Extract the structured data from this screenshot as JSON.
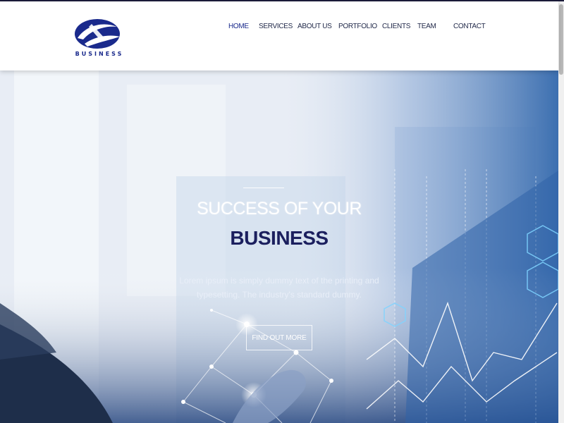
{
  "brand": {
    "logo_text": "BUSINESS",
    "color": "#1a2a8c"
  },
  "nav": {
    "items": [
      {
        "label": "HOME",
        "active": true
      },
      {
        "label": "SERVICES"
      },
      {
        "label": "ABOUT US"
      },
      {
        "label": "PORTFOLIO"
      },
      {
        "label": "CLIENTS"
      },
      {
        "label": "TEAM"
      },
      {
        "label": "CONTACT"
      }
    ]
  },
  "hero": {
    "title_line1": "SUCCESS OF YOUR",
    "title_line2": "BUSINESS",
    "description": "Lorem ipsum is simply dummy text of the printing and typesetting. The industry's standard dummy.",
    "button_label": "FIND OUT MORE"
  },
  "colors": {
    "title_dark": "#1b1f5e",
    "nav_text": "#222a4a"
  }
}
